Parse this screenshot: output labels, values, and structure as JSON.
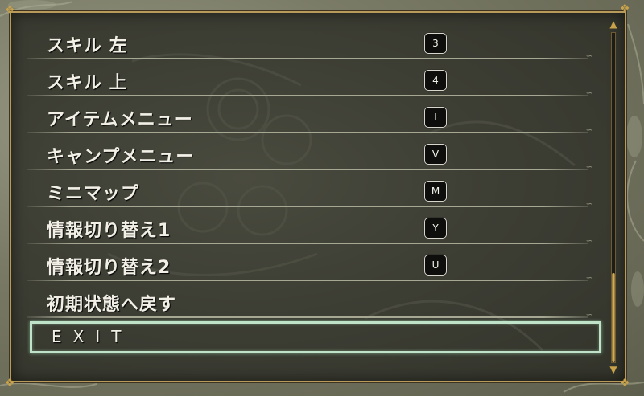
{
  "menu": {
    "items": [
      {
        "label": "スキル 左",
        "key": "3"
      },
      {
        "label": "スキル 上",
        "key": "4"
      },
      {
        "label": "アイテムメニュー",
        "key": "I"
      },
      {
        "label": "キャンプメニュー",
        "key": "V"
      },
      {
        "label": "ミニマップ",
        "key": "M"
      },
      {
        "label": "情報切り替え1",
        "key": "Y"
      },
      {
        "label": "情報切り替え2",
        "key": "U"
      },
      {
        "label": "初期状態へ戻す"
      },
      {
        "label": "EXIT",
        "selected": true
      }
    ]
  },
  "scrollbar": {
    "position_fraction": 1.0,
    "visible_fraction": 0.27
  },
  "colors": {
    "frame_gold": "#b89a5a",
    "panel_bg": "#3d3e34",
    "text": "#f2f0e6",
    "selection": "#bfe2c9",
    "key_bg": "#0e0e0d"
  },
  "icons": {
    "scroll_up": "gold-triangle-up-icon",
    "scroll_down": "gold-triangle-down-icon"
  }
}
